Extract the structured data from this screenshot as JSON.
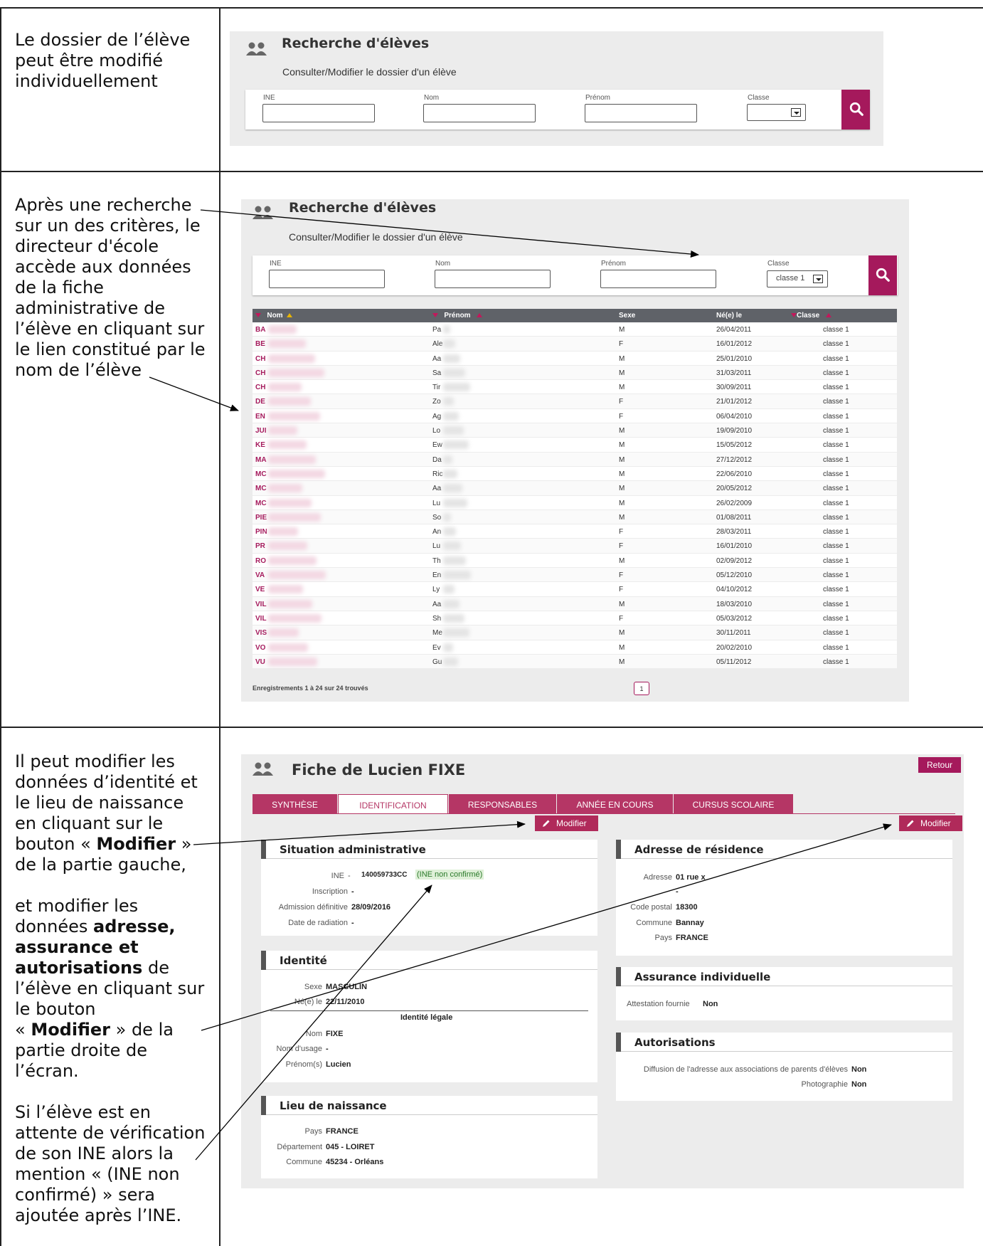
{
  "rows": [
    {
      "text": "Le dossier de l’élève\npeut être modifié\nindividuellement"
    },
    {
      "text": "Après une recherche\nsur un des critères, le\ndirecteur d'école\naccède aux données\nde la fiche\nadministrative de\nl’élève en cliquant sur\nle lien constitué par le\nnom de l’élève"
    },
    {
      "p1a": "Il peut modifier les\ndonnées d’identité et\nle lieu de naissance\nen cliquant sur le\nbouton « ",
      "p1b": "Modifier",
      "p1c": " »\nde la partie gauche,",
      "p2a": "et modifier les\ndonnées ",
      "p2b": "adresse,\nassurance et\nautorisations",
      "p2c": " de\nl’élève en cliquant sur\nle bouton\n« ",
      "p2d": "Modifier",
      "p2e": " » de la\npartie droite de\nl’écran.",
      "p3": "Si l’élève est en\nattente de vérification\nde son INE alors la\nmention « (INE non\nconfirmé) » sera\najoutée après l’INE."
    }
  ],
  "search1": {
    "title": "Recherche d'élèves",
    "subtitle": "Consulter/Modifier le dossier d'un élève",
    "ine_label": "INE",
    "nom_label": "Nom",
    "prenom_label": "Prénom",
    "classe_label": "Classe",
    "classe_value": "",
    "icon": "people-icon",
    "search_icon": "search-icon"
  },
  "search2": {
    "title": "Recherche d'élèves",
    "subtitle": "Consulter/Modifier le dossier d'un élève",
    "ine_label": "INE",
    "nom_label": "Nom",
    "prenom_label": "Prénom",
    "classe_label": "Classe",
    "classe_value": "classe 1"
  },
  "table": {
    "headers": {
      "nom": "Nom",
      "prenom": "Prénom",
      "sexe": "Sexe",
      "ne": "Né(e) le",
      "classe": "Classe"
    },
    "rows": [
      {
        "nom": "BA",
        "prenom": "Pa",
        "sexe": "M",
        "ne": "26/04/2011",
        "classe": "classe 1"
      },
      {
        "nom": "BE",
        "prenom": "Ale",
        "sexe": "F",
        "ne": "16/01/2012",
        "classe": "classe 1"
      },
      {
        "nom": "CH",
        "prenom": "Aa",
        "sexe": "M",
        "ne": "25/01/2010",
        "classe": "classe 1"
      },
      {
        "nom": "CH",
        "prenom": "Sa",
        "sexe": "M",
        "ne": "31/03/2011",
        "classe": "classe 1"
      },
      {
        "nom": "CH",
        "prenom": "Tir",
        "sexe": "M",
        "ne": "30/09/2011",
        "classe": "classe 1"
      },
      {
        "nom": "DE",
        "prenom": "Zo",
        "sexe": "F",
        "ne": "21/01/2012",
        "classe": "classe 1"
      },
      {
        "nom": "EN",
        "prenom": "Ag",
        "sexe": "F",
        "ne": "06/04/2010",
        "classe": "classe 1"
      },
      {
        "nom": "JUI",
        "prenom": "Lo",
        "sexe": "M",
        "ne": "19/09/2010",
        "classe": "classe 1"
      },
      {
        "nom": "KE",
        "prenom": "Ew",
        "sexe": "M",
        "ne": "15/05/2012",
        "classe": "classe 1"
      },
      {
        "nom": "MA",
        "prenom": "Da",
        "sexe": "M",
        "ne": "27/12/2012",
        "classe": "classe 1"
      },
      {
        "nom": "MC",
        "prenom": "Ric",
        "sexe": "M",
        "ne": "22/06/2010",
        "classe": "classe 1"
      },
      {
        "nom": "MC",
        "prenom": "Aa",
        "sexe": "M",
        "ne": "20/05/2012",
        "classe": "classe 1"
      },
      {
        "nom": "MC",
        "prenom": "Lu",
        "sexe": "M",
        "ne": "26/02/2009",
        "classe": "classe 1"
      },
      {
        "nom": "PIE",
        "prenom": "So",
        "sexe": "M",
        "ne": "01/08/2011",
        "classe": "classe 1"
      },
      {
        "nom": "PIN",
        "prenom": "An",
        "sexe": "F",
        "ne": "28/03/2011",
        "classe": "classe 1"
      },
      {
        "nom": "PR",
        "prenom": "Lu",
        "sexe": "F",
        "ne": "16/01/2010",
        "classe": "classe 1"
      },
      {
        "nom": "RO",
        "prenom": "Th",
        "sexe": "M",
        "ne": "02/09/2012",
        "classe": "classe 1"
      },
      {
        "nom": "VA",
        "prenom": "En",
        "sexe": "F",
        "ne": "05/12/2010",
        "classe": "classe 1"
      },
      {
        "nom": "VE",
        "prenom": "Ly",
        "sexe": "F",
        "ne": "04/10/2012",
        "classe": "classe 1"
      },
      {
        "nom": "VIL",
        "prenom": "Aa",
        "sexe": "M",
        "ne": "18/03/2010",
        "classe": "classe 1"
      },
      {
        "nom": "VIL",
        "prenom": "Sh",
        "sexe": "F",
        "ne": "05/03/2012",
        "classe": "classe 1"
      },
      {
        "nom": "VIS",
        "prenom": "Me",
        "sexe": "M",
        "ne": "30/11/2011",
        "classe": "classe 1"
      },
      {
        "nom": "VO",
        "prenom": "Ev",
        "sexe": "M",
        "ne": "20/02/2010",
        "classe": "classe 1"
      },
      {
        "nom": "VU",
        "prenom": "Gu",
        "sexe": "M",
        "ne": "05/11/2012",
        "classe": "classe 1"
      }
    ],
    "footer": "Enregistrements 1 à 24 sur 24 trouvés",
    "page": "1"
  },
  "fiche": {
    "title": "Fiche de Lucien FIXE",
    "retour": "Retour",
    "tabs": [
      "SYNTHÈSE",
      "IDENTIFICATION",
      "RESPONSABLES",
      "ANNÉE EN COURS",
      "CURSUS SCOLAIRE"
    ],
    "modifier": "Modifier",
    "situation": {
      "title": "Situation administrative",
      "ine_l": "INE",
      "ine_v": "140059733CC",
      "ine_note": "(INE non confirmé)",
      "insc_l": "Inscription",
      "insc_v": "-",
      "adm_l": "Admission définitive",
      "adm_v": "28/09/2016",
      "rad_l": "Date de radiation",
      "rad_v": "-"
    },
    "identite": {
      "title": "Identité",
      "sexe_l": "Sexe",
      "sexe_v": "MASCULIN",
      "ne_l": "Né(e) le",
      "ne_v": "22/11/2010",
      "legale": "Identité légale",
      "nom_l": "Nom",
      "nom_v": "FIXE",
      "usage_l": "Nom d'usage",
      "usage_v": "-",
      "prenom_l": "Prénom(s)",
      "prenom_v": "Lucien"
    },
    "naissance": {
      "title": "Lieu de naissance",
      "pays_l": "Pays",
      "pays_v": "FRANCE",
      "dep_l": "Département",
      "dep_v": "045 - LOIRET",
      "com_l": "Commune",
      "com_v": "45234 - Orléans"
    },
    "adresse": {
      "title": "Adresse de résidence",
      "adr_l": "Adresse",
      "adr_v": "01 rue x",
      "adr2": "-",
      "cp_l": "Code postal",
      "cp_v": "18300",
      "com_l": "Commune",
      "com_v": "Bannay",
      "pays_l": "Pays",
      "pays_v": "FRANCE"
    },
    "assurance": {
      "title": "Assurance individuelle",
      "att_l": "Attestation fournie",
      "att_v": "Non"
    },
    "autorisations": {
      "title": "Autorisations",
      "diff_l": "Diffusion de l'adresse aux associations de parents d'élèves",
      "diff_v": "Non",
      "photo_l": "Photographie",
      "photo_v": "Non"
    }
  },
  "colors": {
    "accent": "#a5195c",
    "tab": "#b53665",
    "panel": "#ececec"
  }
}
